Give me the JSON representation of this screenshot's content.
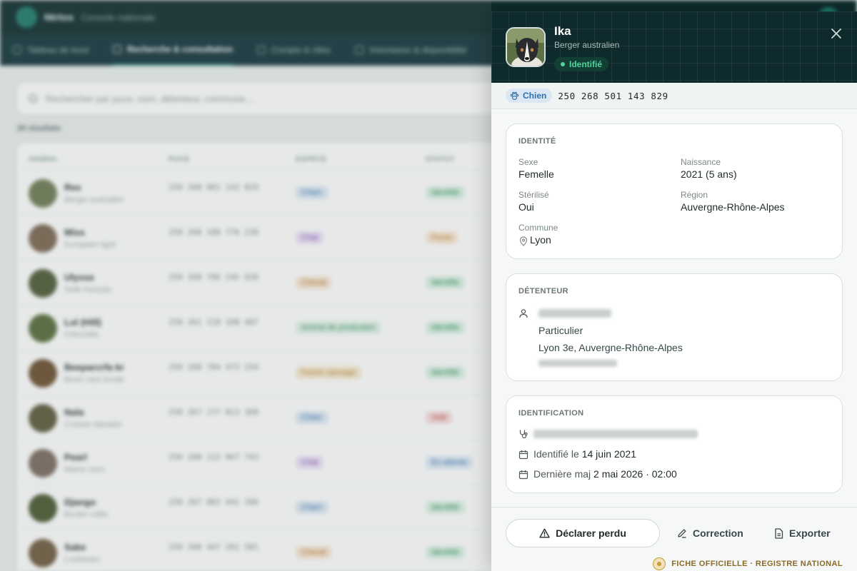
{
  "background": {
    "app_name": "Ntrtos",
    "app_subtitle": "Console nationale",
    "nav_tabs": [
      {
        "label": "Tableau de bord"
      },
      {
        "label": "Recherche & consultation"
      },
      {
        "label": "Compte & rôles"
      },
      {
        "label": "Volontaires & disponibilité"
      }
    ],
    "search_placeholder": "Rechercher par puce, nom, détenteur, commune…",
    "results_count": "30 résultats",
    "table_headers": [
      "ANIMAL",
      "PUCE",
      "ESPÈCE",
      "STATUT"
    ],
    "rows": [
      {
        "name": "Rex",
        "breed": "Berger australien",
        "chip": "250 268 901 143 829",
        "species": "Chien",
        "status": "Identifié",
        "sp_bg": "#dce8f4",
        "sp_fg": "#2f6fb0",
        "st_bg": "#dbf1e4",
        "st_fg": "#1f8a4c",
        "av": "#6d7a52"
      },
      {
        "name": "Miss",
        "breed": "Européen tigré",
        "chip": "250 268 188 776 238",
        "species": "Chat",
        "status": "Perdu",
        "sp_bg": "#ece1f7",
        "sp_fg": "#7a44b8",
        "st_bg": "#fbe9d6",
        "st_fg": "#c0741d",
        "av": "#7b6650"
      },
      {
        "name": "Ulysse",
        "breed": "Selle français",
        "chip": "250 268 796 145 920",
        "species": "Cheval",
        "status": "Identifié",
        "sp_bg": "#f8e7d3",
        "sp_fg": "#b46c1f",
        "st_bg": "#dbf1e4",
        "st_fg": "#1f8a4c",
        "av": "#4e5a35"
      },
      {
        "name": "Lol (Hill)",
        "breed": "Chinchilla",
        "chip": "250 261 118 108 487",
        "species": "Animal de production",
        "status": "Identifié",
        "sp_bg": "#dff2e6",
        "sp_fg": "#2e8b57",
        "st_bg": "#dbf1e4",
        "st_fg": "#1f8a4c",
        "av": "#556b3a"
      },
      {
        "name": "Beeparcrfa kr",
        "breed": "Bovin race locale",
        "chip": "250 268 784 473 254",
        "species": "Faune sauvage",
        "status": "Identifié",
        "sp_bg": "#f8ead0",
        "sp_fg": "#b2802a",
        "st_bg": "#dbf1e4",
        "st_fg": "#1f8a4c",
        "av": "#6b4e2e"
      },
      {
        "name": "Nala",
        "breed": "Croisée labrador",
        "chip": "250 267 177 813 368",
        "species": "Chien",
        "status": "Volé",
        "sp_bg": "#dce8f4",
        "sp_fg": "#2f6fb0",
        "st_bg": "#f9dcdc",
        "st_fg": "#c43a3a",
        "av": "#5d5a3b"
      },
      {
        "name": "Pearl",
        "breed": "Maine coon",
        "chip": "250 268 112 967 743",
        "species": "Chat",
        "status": "En attente",
        "sp_bg": "#ece1f7",
        "sp_fg": "#7a44b8",
        "st_bg": "#dce8f4",
        "st_fg": "#2f6fb0",
        "av": "#7a6a5e"
      },
      {
        "name": "Django",
        "breed": "Border collie",
        "chip": "250 267 883 441 396",
        "species": "Chien",
        "status": "Identifié",
        "sp_bg": "#dce8f4",
        "sp_fg": "#2f6fb0",
        "st_bg": "#dbf1e4",
        "st_fg": "#1f8a4c",
        "av": "#48582f"
      },
      {
        "name": "Sake",
        "breed": "Lusitanien",
        "chip": "250 268 447 201 581",
        "species": "Cheval",
        "status": "Identifié",
        "sp_bg": "#f8e7d3",
        "sp_fg": "#b46c1f",
        "st_bg": "#dbf1e4",
        "st_fg": "#1f8a4c",
        "av": "#6e5a3e"
      }
    ]
  },
  "drawer": {
    "pet_name": "Ika",
    "pet_breed": "Berger australien",
    "status": "Identifié",
    "species": "Chien",
    "chip_number": "250 268 501 143 829",
    "identity": {
      "title": "IDENTITÉ",
      "sex_label": "Sexe",
      "sex": "Femelle",
      "birth_label": "Naissance",
      "birth": "2021 (5 ans)",
      "sterilized_label": "Stérilisé",
      "sterilized": "Oui",
      "region_label": "Région",
      "region": "Auvergne-Rhône-Alpes",
      "commune_label": "Commune",
      "commune": "Lyon"
    },
    "holder": {
      "title": "DÉTENTEUR",
      "type": "Particulier",
      "address": "Lyon 3e, Auvergne-Rhône-Alpes"
    },
    "identification": {
      "title": "IDENTIFICATION",
      "identified_prefix": "Identifié le",
      "identified_date": "14 juin 2021",
      "updated_prefix": "Dernière maj",
      "updated_date": "2 mai 2026 · 02:00"
    },
    "actions": {
      "lost": "Déclarer perdu",
      "correction": "Correction",
      "export": "Exporter"
    },
    "official_note": "FICHE OFFICIELLE · REGISTRE NATIONAL"
  },
  "colors": {
    "header_bg": "#0f2a2c",
    "status_green": "#52d39b",
    "species_blue": "#2f6fb0",
    "seal_gold": "#c49a3a"
  },
  "icons": {
    "close": "close-icon",
    "species": "paw-icon",
    "commune": "map-pin-icon",
    "holder": "user-icon",
    "vet": "stethoscope-icon",
    "calendar": "calendar-icon",
    "lost": "warning-icon",
    "correction": "pencil-icon",
    "export": "file-icon"
  }
}
